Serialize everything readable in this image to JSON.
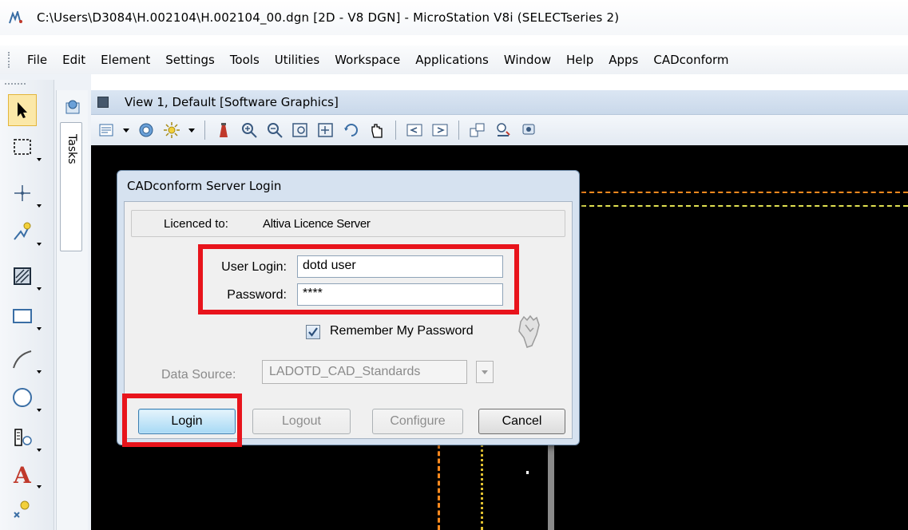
{
  "window": {
    "title": "C:\\Users\\D3084\\H.002104\\H.002104_00.dgn [2D - V8 DGN] - MicroStation V8i (SELECTseries 2)",
    "app_icon": "microstation-icon"
  },
  "menubar": {
    "items": [
      "File",
      "Edit",
      "Element",
      "Settings",
      "Tools",
      "Utilities",
      "Workspace",
      "Applications",
      "Window",
      "Help",
      "Apps",
      "CADconform"
    ]
  },
  "tasks": {
    "label": "Tasks"
  },
  "view": {
    "title": "View 1, Default [Software Graphics]",
    "background": "#000000"
  },
  "left_tools": [
    "select-arrow-icon",
    "place-fence-icon",
    "place-point-icon",
    "smartline-icon",
    "hatch-icon",
    "rectangle-icon",
    "arc-icon",
    "circle-icon",
    "cell-icon",
    "text-icon",
    "tag-icon"
  ],
  "dialog": {
    "title": "CADconform Server Login",
    "licence_label": "Licenced to:",
    "licence_value": "Altiva Licence Server",
    "user_login_label": "User Login:",
    "user_login_value": "dotd user",
    "password_label": "Password:",
    "password_value": "****",
    "remember_label": "Remember My Password",
    "remember_checked": true,
    "data_source_label": "Data Source:",
    "data_source_value": "LADOTD_CAD_Standards",
    "buttons": {
      "login": "Login",
      "logout": "Logout",
      "configure": "Configure",
      "cancel": "Cancel"
    }
  },
  "colors": {
    "highlight_box": "#e8141c",
    "dashed_orange": "#ff8a1e",
    "dashed_yellow": "#e0e050"
  }
}
